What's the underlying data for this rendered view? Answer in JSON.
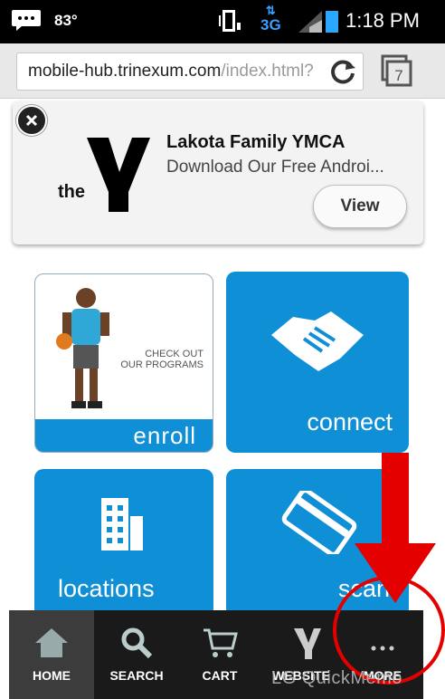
{
  "status_bar": {
    "temperature": "83°",
    "network": "3G",
    "time": "1:18 PM"
  },
  "browser": {
    "url_host": "mobile-hub.trinexum.com",
    "url_path": "/index.html?",
    "tab_count": "7"
  },
  "ad": {
    "logo_text": "the",
    "title": "Lakota Family YMCA",
    "description": "Download Our Free Androi...",
    "button_label": "View"
  },
  "tiles": {
    "enroll": {
      "label": "enroll",
      "tagline_line1": "CHECK OUT",
      "tagline_line2": "OUR PROGRAMS"
    },
    "connect": {
      "label": "connect"
    },
    "locations": {
      "label": "locations"
    },
    "scan": {
      "label": "scan"
    }
  },
  "bottom_nav": {
    "items": [
      {
        "label": "HOME",
        "icon": "home-icon"
      },
      {
        "label": "SEARCH",
        "icon": "search-icon"
      },
      {
        "label": "CART",
        "icon": "cart-icon"
      },
      {
        "label": "WEBSITE",
        "icon": "ymca-logo-icon"
      },
      {
        "label": "MORE",
        "icon": "more-icon"
      }
    ],
    "active_index": 0
  },
  "watermark": "LG QuickMemo",
  "colors": {
    "accent_blue": "#0f8fd6",
    "annotation_red": "#e50000"
  }
}
